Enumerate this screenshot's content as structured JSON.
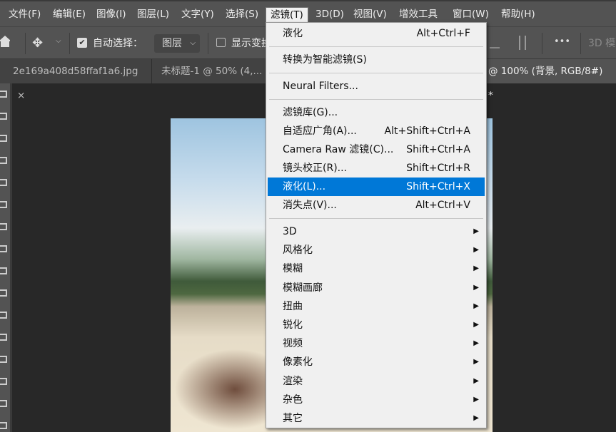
{
  "menubar": [
    "文件(F)",
    "编辑(E)",
    "图像(I)",
    "图层(L)",
    "文字(Y)",
    "选择(S)",
    "滤镜(T)",
    "3D(D)",
    "视图(V)",
    "增效工具",
    "窗口(W)",
    "帮助(H)"
  ],
  "options": {
    "auto_select_label": "自动选择：",
    "auto_select_checked": true,
    "layer_select": "图层",
    "show_transform_label": "显示变换控件",
    "more": "•••",
    "mode3d": "3D 模"
  },
  "tabs": [
    {
      "title": "2e169a408d58ffaf1a6.jpg",
      "close": "×"
    },
    {
      "title": "未标题-1 @ 50% (4,..."
    },
    {
      "title": "@ 100% (背景, RGB/8#) *"
    }
  ],
  "filter_menu": {
    "items": [
      {
        "label": "液化",
        "shortcut": "Alt+Ctrl+F"
      },
      {
        "sep": true
      },
      {
        "label": "转换为智能滤镜(S)"
      },
      {
        "sep": true
      },
      {
        "label": "Neural Filters..."
      },
      {
        "sep": true
      },
      {
        "label": "滤镜库(G)..."
      },
      {
        "label": "自适应广角(A)...",
        "shortcut": "Alt+Shift+Ctrl+A"
      },
      {
        "label": "Camera Raw 滤镜(C)...",
        "shortcut": "Shift+Ctrl+A"
      },
      {
        "label": "镜头校正(R)...",
        "shortcut": "Shift+Ctrl+R"
      },
      {
        "label": "液化(L)...",
        "shortcut": "Shift+Ctrl+X",
        "highlighted": true
      },
      {
        "label": "消失点(V)...",
        "shortcut": "Alt+Ctrl+V"
      },
      {
        "sep": true
      },
      {
        "label": "3D",
        "submenu": true
      },
      {
        "label": "风格化",
        "submenu": true
      },
      {
        "label": "模糊",
        "submenu": true
      },
      {
        "label": "模糊画廊",
        "submenu": true
      },
      {
        "label": "扭曲",
        "submenu": true
      },
      {
        "label": "锐化",
        "submenu": true
      },
      {
        "label": "视频",
        "submenu": true
      },
      {
        "label": "像素化",
        "submenu": true
      },
      {
        "label": "渲染",
        "submenu": true
      },
      {
        "label": "杂色",
        "submenu": true
      },
      {
        "label": "其它",
        "submenu": true
      }
    ]
  },
  "colors": {
    "highlight": "#0078d7",
    "menubar": "#535353",
    "canvas": "#282828"
  }
}
